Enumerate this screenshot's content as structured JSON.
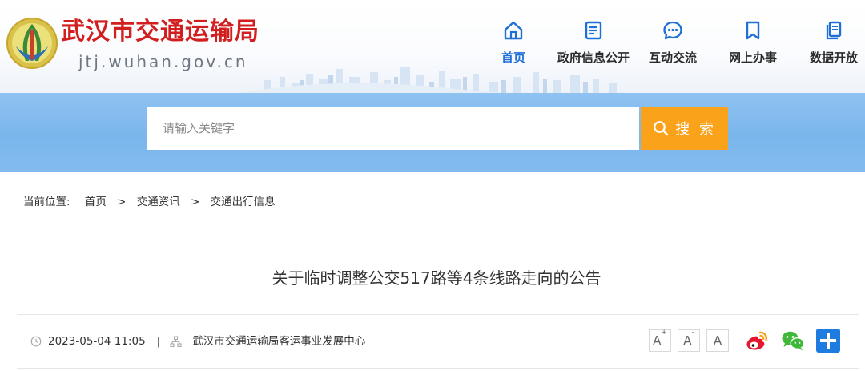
{
  "header": {
    "site_title": "武汉市交通运输局",
    "site_domain": "jtj.wuhan.gov.cn",
    "logo_icon": "wuhan-emblem-icon"
  },
  "nav": {
    "items": [
      {
        "label": "首页",
        "icon": "home-icon",
        "active": true
      },
      {
        "label": "政府信息公开",
        "icon": "document-list-icon",
        "active": false
      },
      {
        "label": "互动交流",
        "icon": "chat-bubble-icon",
        "active": false
      },
      {
        "label": "网上办事",
        "icon": "bookmark-icon",
        "active": false
      },
      {
        "label": "数据开放",
        "icon": "copy-docs-icon",
        "active": false
      }
    ],
    "active_color": "#1e6fd6"
  },
  "search": {
    "placeholder": "请输入关键字",
    "button_label": "搜 索",
    "button_color": "#fba21b"
  },
  "breadcrumb": {
    "label": "当前位置:",
    "items": [
      "首页",
      "交通资讯",
      "交通出行信息"
    ],
    "separator": ">"
  },
  "article": {
    "title": "关于临时调整公交517路等4条线路走向的公告",
    "date": "2023-05-04 11:05",
    "divider": "|",
    "source": "武汉市交通运输局客运事业发展中心"
  },
  "tools": {
    "font_sizes": [
      "A+",
      "A-",
      "A"
    ],
    "share": [
      "weibo-icon",
      "wechat-icon",
      "plus-share-icon"
    ]
  },
  "colors": {
    "title_red": "#d21e1e",
    "band_blue": "#7ab6ec",
    "share_plus_blue": "#1e7be0",
    "weibo_red": "#e6162d",
    "wechat_green": "#3fb83a"
  }
}
